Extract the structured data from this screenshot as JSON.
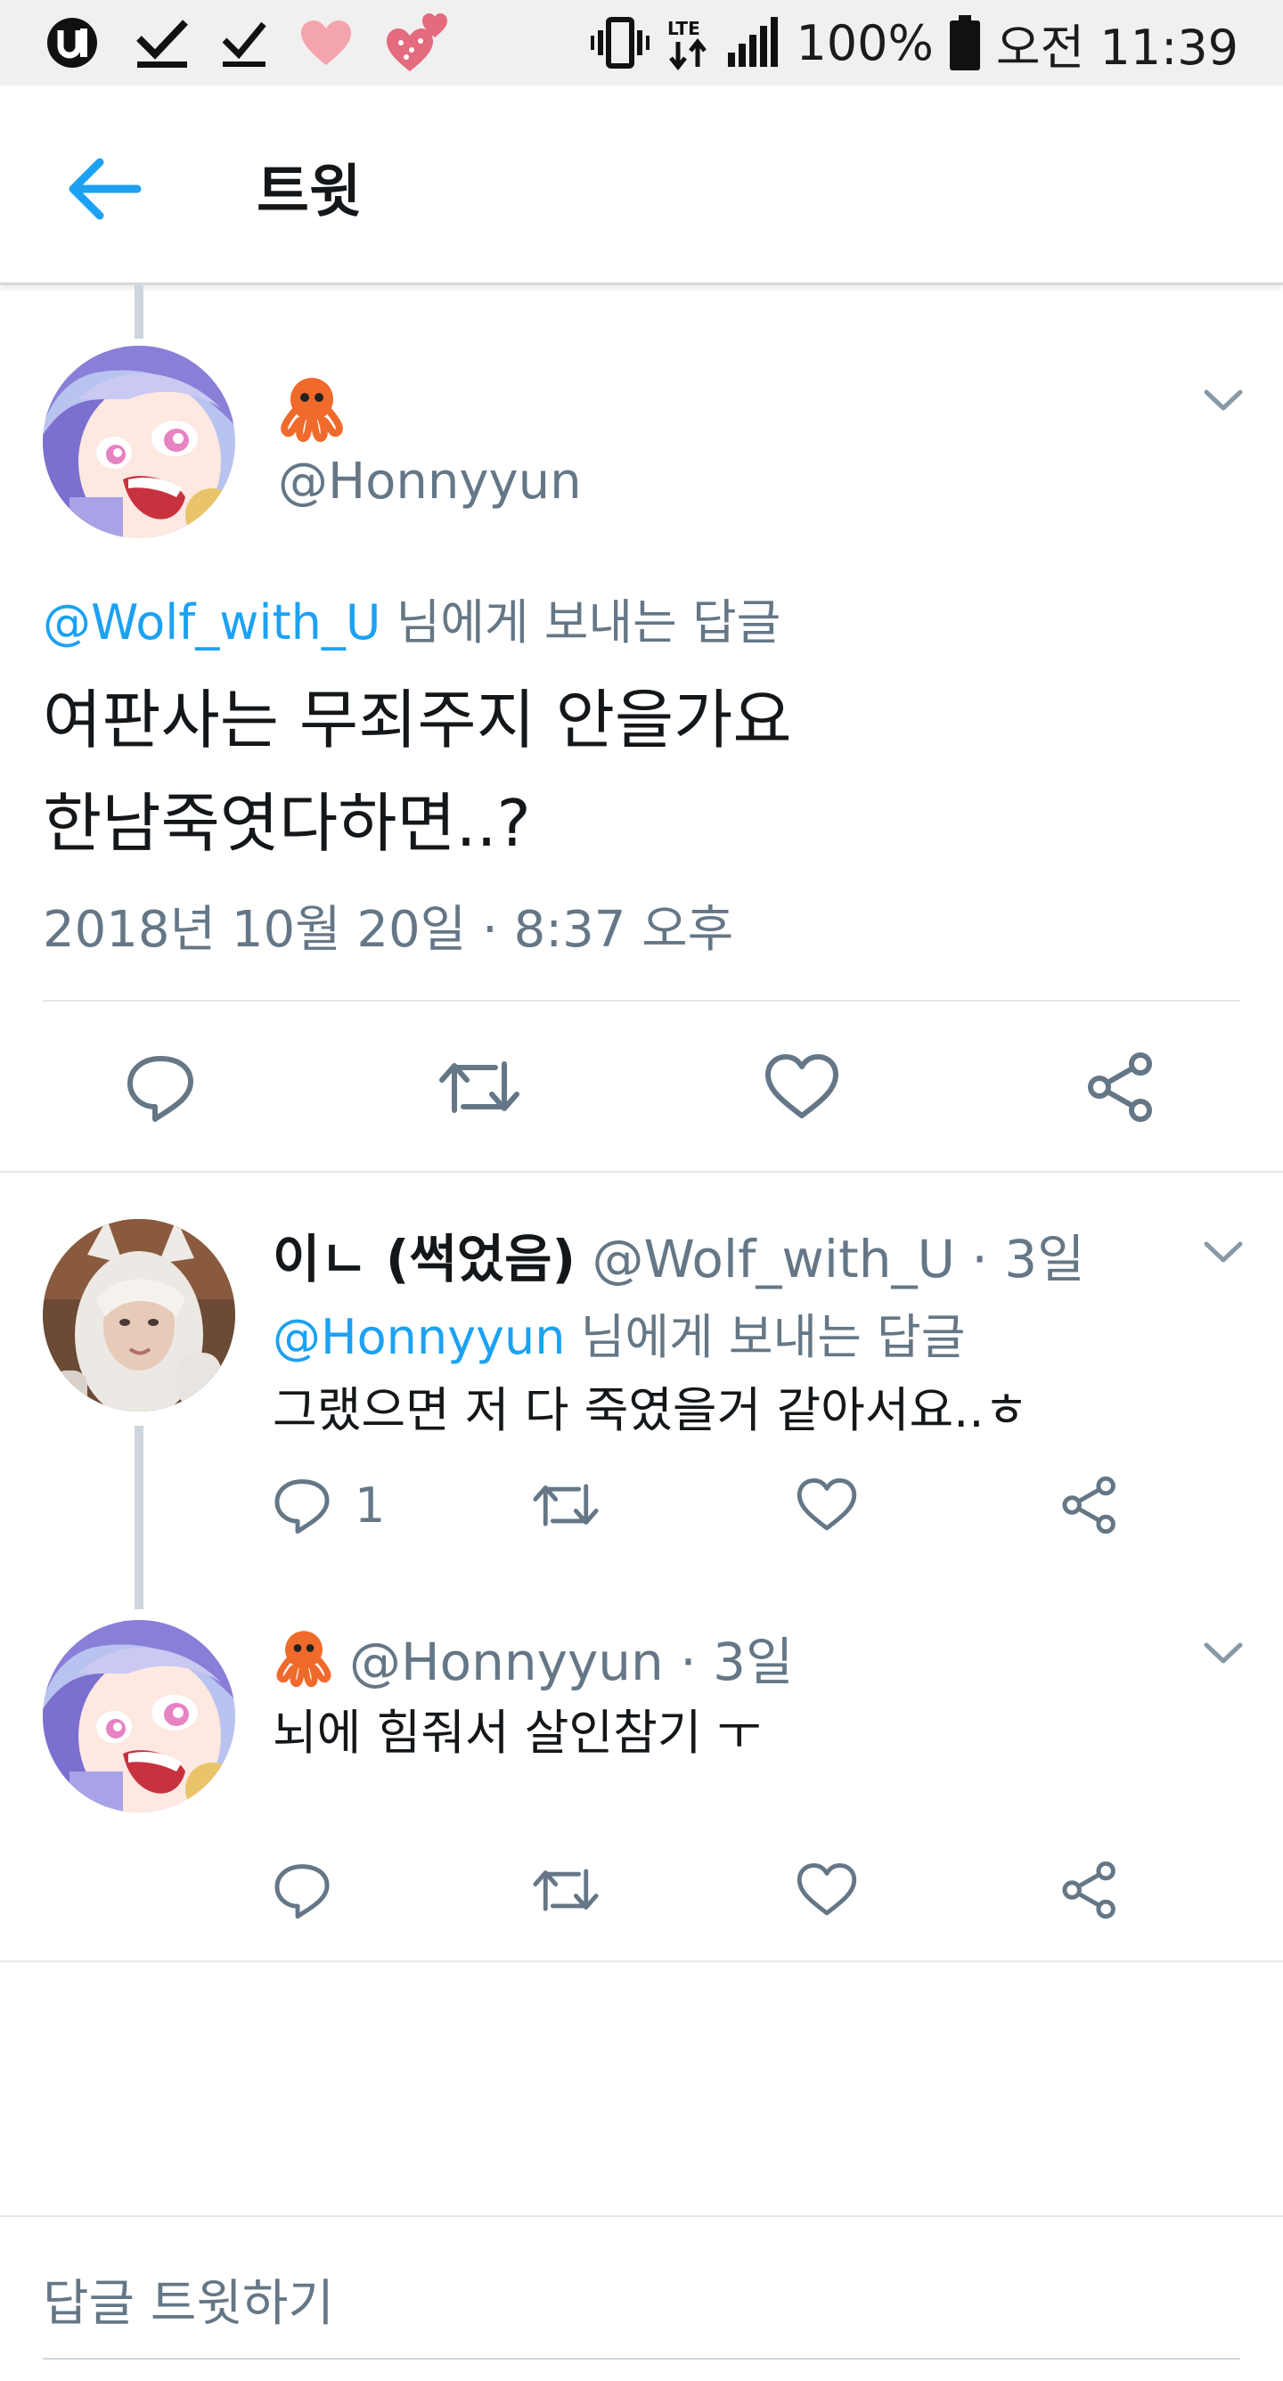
{
  "status_bar": {
    "battery": "100%",
    "time": "오전 11:39"
  },
  "header": {
    "title": "트윗"
  },
  "main_tweet": {
    "handle": "@Honnyyun",
    "reply_prefix": "@Wolf_with_U",
    "reply_suffix": " 님에게 보내는 답글",
    "text_line1": "여판사는 무죄주지 안을가요",
    "text_line2": "한남죽엿다하면..?",
    "timestamp": "2018년 10월 20일 · 8:37 오후"
  },
  "reply1": {
    "name": "이ㄴ (썩었음)",
    "handle": "@Wolf_with_U · 3일",
    "reply_prefix": "@Honnyyun",
    "reply_suffix": " 님에게 보내는 답글",
    "text": "그랬으면 저 다 죽였을거 같아서요..ㅎ",
    "reply_count": "1"
  },
  "reply2": {
    "handle": "@Honnyyun · 3일",
    "text": "뇌에 힘줘서 살인참기 ㅜ"
  },
  "compose": {
    "placeholder": "답글 트윗하기"
  },
  "colors": {
    "accent": "#1da1f2",
    "secondary_text": "#657786",
    "divider": "#e1e8ed",
    "thread_line": "#cdd6dd"
  },
  "icons": [
    "back-arrow-icon",
    "octopus-emoji-icon",
    "chevron-down-icon",
    "reply-icon",
    "retweet-icon",
    "like-icon",
    "share-icon"
  ]
}
